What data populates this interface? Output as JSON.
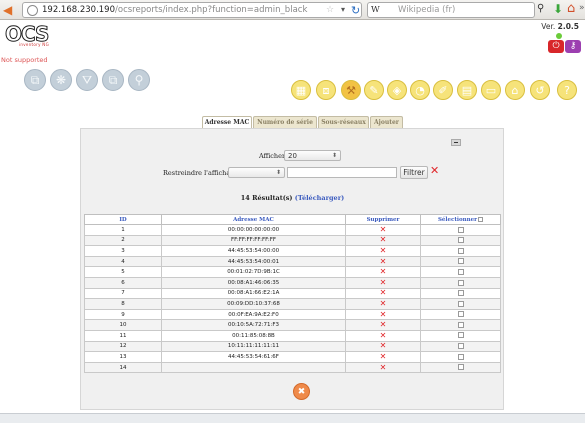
{
  "browser": {
    "url_host": "192.168.230.190",
    "url_path": "/ocsreports/index.php?function=admin_black",
    "search_engine": "W",
    "search_placeholder": "Wikipedia (fr)"
  },
  "header": {
    "logo_text": "OCS",
    "logo_sub": "inventory NG",
    "not_supported": "Not supported",
    "version_label": "Ver.",
    "version_number": "2.0.5"
  },
  "toolbar_left": [
    {
      "name": "computers-icon",
      "glyph": "⧉"
    },
    {
      "name": "network-icon",
      "glyph": "❋"
    },
    {
      "name": "filter-icon",
      "glyph": "⛛"
    },
    {
      "name": "software-icon",
      "glyph": "⧉"
    },
    {
      "name": "search-icon",
      "glyph": "⚲"
    }
  ],
  "toolbar_right": [
    {
      "name": "deploy-icon",
      "glyph": "▦",
      "active": false
    },
    {
      "name": "groups-icon",
      "glyph": "⧈",
      "active": false
    },
    {
      "name": "admin-icon",
      "glyph": "⚒",
      "active": true
    },
    {
      "name": "config-icon",
      "glyph": "✎",
      "active": false
    },
    {
      "name": "tags-icon",
      "glyph": "◈",
      "active": false
    },
    {
      "name": "stats-icon",
      "glyph": "◔",
      "active": false
    },
    {
      "name": "notes-icon",
      "glyph": "✐",
      "active": false
    },
    {
      "name": "calendar-icon",
      "glyph": "▤",
      "active": false
    },
    {
      "name": "card-icon",
      "glyph": "▭",
      "active": false
    },
    {
      "name": "home-tree-icon",
      "glyph": "⌂",
      "active": false
    },
    {
      "name": "refresh-icon",
      "glyph": "↺",
      "active": false
    },
    {
      "name": "help-icon",
      "glyph": "?",
      "active": false
    }
  ],
  "tabs": [
    {
      "label": "Adresse MAC",
      "active": true
    },
    {
      "label": "Numéro de série",
      "active": false
    },
    {
      "label": "Sous-réseaux",
      "active": false
    },
    {
      "label": "Ajouter",
      "active": false
    }
  ],
  "filters": {
    "show_label": "Afficher:",
    "show_value": "20",
    "restrict_label": "Restreindre l'affichage:",
    "restrict_value": "",
    "filter_text": "",
    "filter_button": "Filtrer",
    "clear_icon": "✕"
  },
  "results": {
    "text": "14 Résultat(s)",
    "download": "(Télécharger)"
  },
  "table": {
    "headers": {
      "id": "ID",
      "mac": "Adresse MAC",
      "delete": "Supprimer",
      "select": "Sélectionner"
    },
    "rows": [
      {
        "id": "1",
        "mac": "00:00:00:00:00:00"
      },
      {
        "id": "2",
        "mac": "FF:FF:FF:FF:FF:FF"
      },
      {
        "id": "3",
        "mac": "44:45:53:54:00:00"
      },
      {
        "id": "4",
        "mac": "44:45:53:54:00:01"
      },
      {
        "id": "5",
        "mac": "00:01:02:7D:9B:1C"
      },
      {
        "id": "6",
        "mac": "00:08:A1:46:06:35"
      },
      {
        "id": "7",
        "mac": "00:08:A1:66:E2:1A"
      },
      {
        "id": "8",
        "mac": "00:09:DD:10:37:68"
      },
      {
        "id": "9",
        "mac": "00:0F:EA:9A:E2:F0"
      },
      {
        "id": "10",
        "mac": "00:10:5A:72:71:F3"
      },
      {
        "id": "11",
        "mac": "00:11:85:08:8B"
      },
      {
        "id": "12",
        "mac": "10:11:11:11:11:11"
      },
      {
        "id": "13",
        "mac": "44:45:53:54:61:6F"
      },
      {
        "id": "14",
        "mac": ""
      }
    ],
    "delete_glyph": "✕"
  },
  "colors": {
    "accent_blue": "#3b5bbf",
    "delete_red": "#e0262a",
    "toolbar_yellow": "#f6e37a",
    "toolbar_gray": "#c3cfd9"
  }
}
